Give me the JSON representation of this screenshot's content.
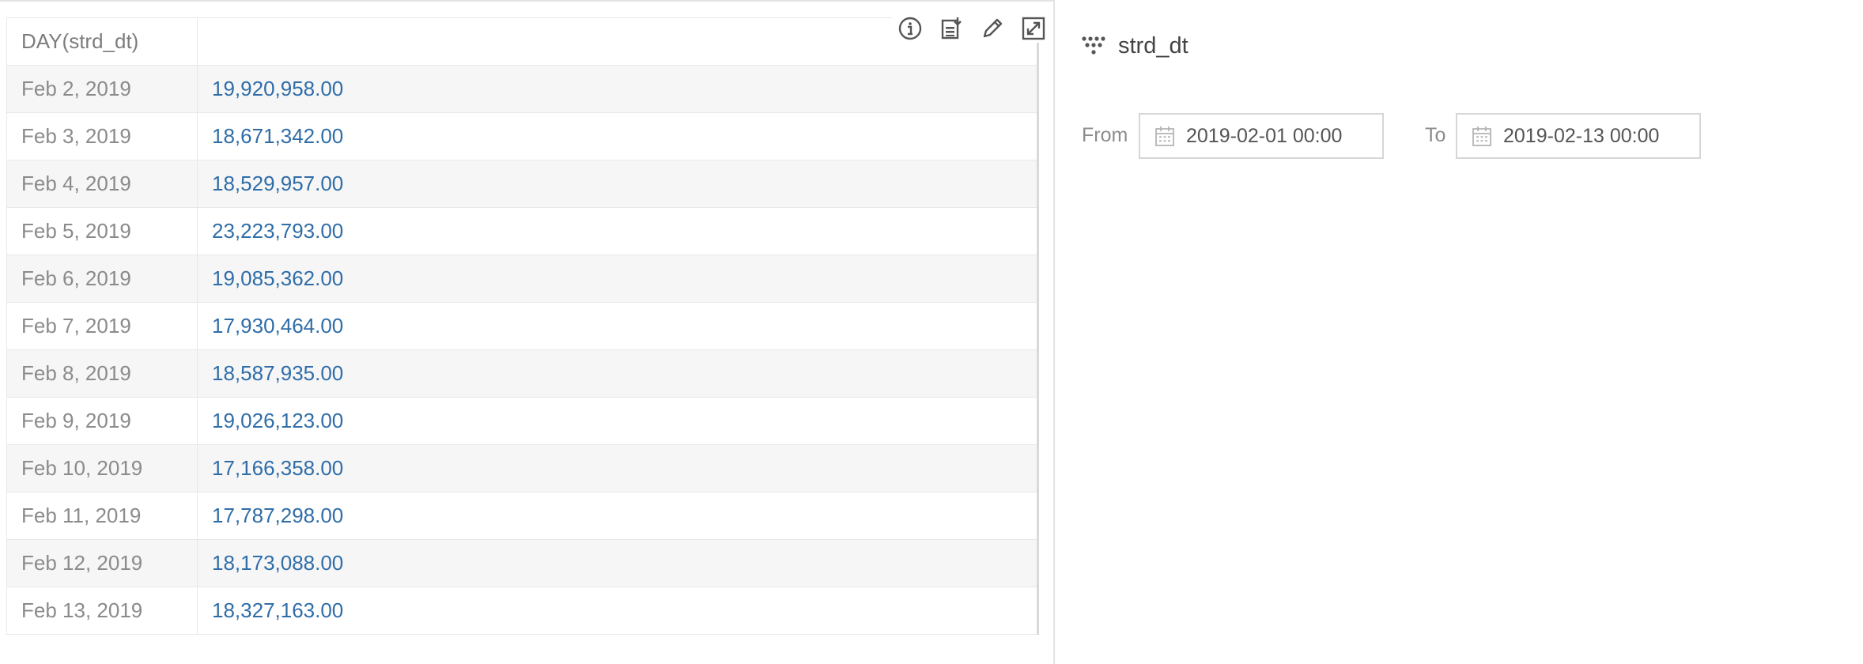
{
  "table": {
    "header": {
      "dimension": "DAY(strd_dt)",
      "measure": ""
    },
    "rows": [
      {
        "date": "Feb 2, 2019",
        "value": "19,920,958.00"
      },
      {
        "date": "Feb 3, 2019",
        "value": "18,671,342.00"
      },
      {
        "date": "Feb 4, 2019",
        "value": "18,529,957.00"
      },
      {
        "date": "Feb 5, 2019",
        "value": "23,223,793.00"
      },
      {
        "date": "Feb 6, 2019",
        "value": "19,085,362.00"
      },
      {
        "date": "Feb 7, 2019",
        "value": "17,930,464.00"
      },
      {
        "date": "Feb 8, 2019",
        "value": "18,587,935.00"
      },
      {
        "date": "Feb 9, 2019",
        "value": "19,026,123.00"
      },
      {
        "date": "Feb 10, 2019",
        "value": "17,166,358.00"
      },
      {
        "date": "Feb 11, 2019",
        "value": "17,787,298.00"
      },
      {
        "date": "Feb 12, 2019",
        "value": "18,173,088.00"
      },
      {
        "date": "Feb 13, 2019",
        "value": "18,327,163.00"
      }
    ]
  },
  "toolbar": {
    "icons": [
      "info-icon",
      "export-icon",
      "pencil-icon",
      "expand-icon"
    ]
  },
  "filter": {
    "title": "strd_dt",
    "icon": "dimension-dots-icon",
    "from_label": "From",
    "from_value": "2019-02-01 00:00",
    "to_label": "To",
    "to_value": "2019-02-13 00:00"
  },
  "colors": {
    "value_text": "#2f6da8",
    "date_text": "#8b8b8b",
    "stripe": "#f6f6f6"
  }
}
